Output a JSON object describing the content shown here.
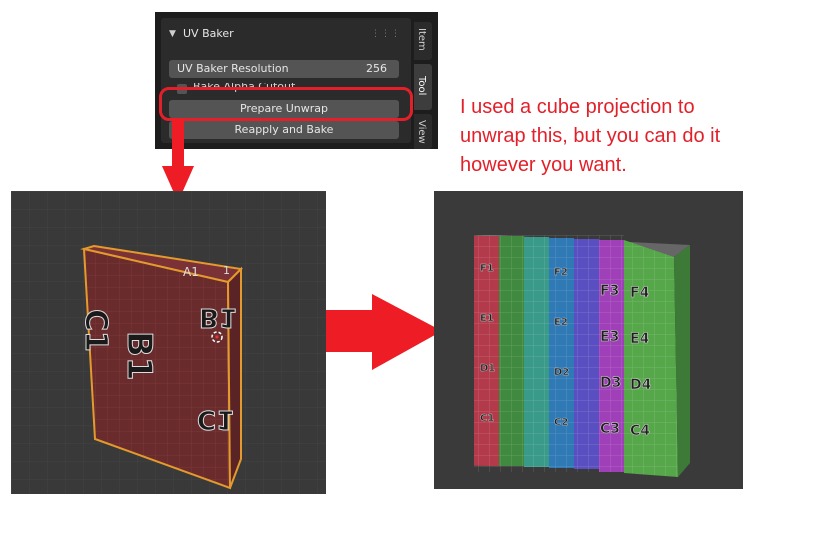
{
  "uv_baker_panel": {
    "title": "UV Baker",
    "resolution_label": "UV Baker Resolution",
    "resolution_value": "256",
    "checkbox_label": "Bake Alpha Cutout",
    "prepare_button": "Prepare Unwrap",
    "reapply_button": "Reapply and Bake",
    "tabs": [
      "Item",
      "Tool",
      "View"
    ],
    "active_tab": "Tool"
  },
  "annotation": {
    "text": "I used a cube projection to unwrap this, but you can do it however you want.",
    "color": "#e3202a"
  },
  "before_viewport": {
    "face_labels": [
      "C1",
      "B1",
      "B1",
      "C1"
    ],
    "top_labels": [
      "A1",
      "1"
    ],
    "selection_color": "#f0a020"
  },
  "after_viewport": {
    "front_labels": [
      "F3",
      "F4",
      "E3",
      "E4",
      "D3",
      "D4",
      "C3",
      "C4"
    ],
    "side_labels": [
      "F1",
      "F2",
      "E1",
      "E2",
      "D1",
      "D2",
      "C1",
      "C2"
    ],
    "rainbow": [
      "#b33a4a",
      "#3f8a3e",
      "#3a9a8a",
      "#2f79b5",
      "#5a4fc0",
      "#a040b8",
      "#56a64a"
    ]
  },
  "arrows": {
    "color": "#ee1c24"
  }
}
